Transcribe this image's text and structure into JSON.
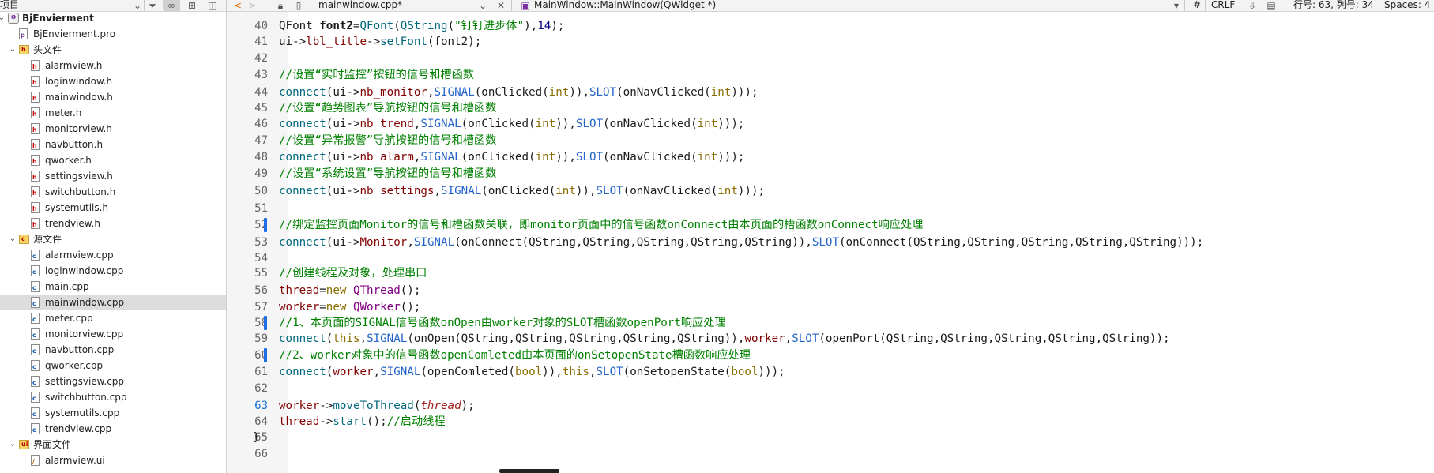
{
  "toolbar": {
    "project_label": "项目",
    "file_tab": "mainwindow.cpp*",
    "function_selector": "MainWindow::MainWindow(QWidget *)",
    "hash_label": "#",
    "line_ending": "CRLF",
    "cursor_position": "行号: 63, 列号: 34",
    "indentation": "Spaces: 4"
  },
  "tree": {
    "items": [
      {
        "label": "BjEnvierment",
        "kind": "project",
        "depth": 0,
        "arrow": "open",
        "bold": true
      },
      {
        "label": "BjEnvierment.pro",
        "kind": "pro",
        "depth": 1
      },
      {
        "label": "头文件",
        "kind": "folder-h",
        "depth": 1,
        "arrow": "open"
      },
      {
        "label": "alarmview.h",
        "kind": "h",
        "depth": 2
      },
      {
        "label": "loginwindow.h",
        "kind": "h",
        "depth": 2
      },
      {
        "label": "mainwindow.h",
        "kind": "h",
        "depth": 2
      },
      {
        "label": "meter.h",
        "kind": "h",
        "depth": 2
      },
      {
        "label": "monitorview.h",
        "kind": "h",
        "depth": 2
      },
      {
        "label": "navbutton.h",
        "kind": "h",
        "depth": 2
      },
      {
        "label": "qworker.h",
        "kind": "h",
        "depth": 2
      },
      {
        "label": "settingsview.h",
        "kind": "h",
        "depth": 2
      },
      {
        "label": "switchbutton.h",
        "kind": "h",
        "depth": 2
      },
      {
        "label": "systemutils.h",
        "kind": "h",
        "depth": 2
      },
      {
        "label": "trendview.h",
        "kind": "h",
        "depth": 2
      },
      {
        "label": "源文件",
        "kind": "folder-c",
        "depth": 1,
        "arrow": "open"
      },
      {
        "label": "alarmview.cpp",
        "kind": "cpp",
        "depth": 2
      },
      {
        "label": "loginwindow.cpp",
        "kind": "cpp",
        "depth": 2
      },
      {
        "label": "main.cpp",
        "kind": "cpp",
        "depth": 2
      },
      {
        "label": "mainwindow.cpp",
        "kind": "cpp",
        "depth": 2,
        "selected": true
      },
      {
        "label": "meter.cpp",
        "kind": "cpp",
        "depth": 2
      },
      {
        "label": "monitorview.cpp",
        "kind": "cpp",
        "depth": 2
      },
      {
        "label": "navbutton.cpp",
        "kind": "cpp",
        "depth": 2
      },
      {
        "label": "qworker.cpp",
        "kind": "cpp",
        "depth": 2
      },
      {
        "label": "settingsview.cpp",
        "kind": "cpp",
        "depth": 2
      },
      {
        "label": "switchbutton.cpp",
        "kind": "cpp",
        "depth": 2
      },
      {
        "label": "systemutils.cpp",
        "kind": "cpp",
        "depth": 2
      },
      {
        "label": "trendview.cpp",
        "kind": "cpp",
        "depth": 2
      },
      {
        "label": "界面文件",
        "kind": "folder-ui",
        "depth": 1,
        "arrow": "open"
      },
      {
        "label": "alarmview.ui",
        "kind": "ui",
        "depth": 2
      }
    ]
  },
  "editor": {
    "current_line": 63,
    "changed_lines": [
      52,
      58,
      60
    ],
    "lines": [
      {
        "n": 40,
        "tokens": [
          [
            "QFont ",
            "t-var"
          ],
          [
            "font2",
            "t-bold"
          ],
          [
            "=",
            ""
          ],
          [
            "QFont",
            "t-fn"
          ],
          [
            "(",
            ""
          ],
          [
            "QString",
            "t-fn"
          ],
          [
            "(",
            ""
          ],
          [
            "\"钉钉进步体\"",
            "t-str"
          ],
          [
            "),",
            ""
          ],
          [
            "14",
            "t-num"
          ],
          [
            ");",
            ""
          ]
        ]
      },
      {
        "n": 41,
        "tokens": [
          [
            "ui->",
            ""
          ],
          [
            "lbl_title",
            "t-mem"
          ],
          [
            "->",
            ""
          ],
          [
            "setFont",
            "t-fn"
          ],
          [
            "(font2);",
            ""
          ]
        ]
      },
      {
        "n": 42,
        "tokens": []
      },
      {
        "n": 43,
        "tokens": [
          [
            "//设置“实时监控”按钮的信号和槽函数",
            "t-cm"
          ]
        ]
      },
      {
        "n": 44,
        "tokens": [
          [
            "connect",
            "t-fn"
          ],
          [
            "(ui->",
            ""
          ],
          [
            "nb_monitor",
            "t-mem"
          ],
          [
            ",",
            ""
          ],
          [
            "SIGNAL",
            "t-macro"
          ],
          [
            "(onClicked(",
            ""
          ],
          [
            "int",
            "t-kw"
          ],
          [
            ")),",
            ""
          ],
          [
            "SLOT",
            "t-macro"
          ],
          [
            "(onNavClicked(",
            ""
          ],
          [
            "int",
            "t-kw"
          ],
          [
            ")));",
            ""
          ]
        ]
      },
      {
        "n": 45,
        "tokens": [
          [
            "//设置“趋势图表”导航按钮的信号和槽函数",
            "t-cm"
          ]
        ]
      },
      {
        "n": 46,
        "tokens": [
          [
            "connect",
            "t-fn"
          ],
          [
            "(ui->",
            ""
          ],
          [
            "nb_trend",
            "t-mem"
          ],
          [
            ",",
            ""
          ],
          [
            "SIGNAL",
            "t-macro"
          ],
          [
            "(onClicked(",
            ""
          ],
          [
            "int",
            "t-kw"
          ],
          [
            ")),",
            ""
          ],
          [
            "SLOT",
            "t-macro"
          ],
          [
            "(onNavClicked(",
            ""
          ],
          [
            "int",
            "t-kw"
          ],
          [
            ")));",
            ""
          ]
        ]
      },
      {
        "n": 47,
        "tokens": [
          [
            "//设置“异常报警”导航按钮的信号和槽函数",
            "t-cm"
          ]
        ]
      },
      {
        "n": 48,
        "tokens": [
          [
            "connect",
            "t-fn"
          ],
          [
            "(ui->",
            ""
          ],
          [
            "nb_alarm",
            "t-mem"
          ],
          [
            ",",
            ""
          ],
          [
            "SIGNAL",
            "t-macro"
          ],
          [
            "(onClicked(",
            ""
          ],
          [
            "int",
            "t-kw"
          ],
          [
            ")),",
            ""
          ],
          [
            "SLOT",
            "t-macro"
          ],
          [
            "(onNavClicked(",
            ""
          ],
          [
            "int",
            "t-kw"
          ],
          [
            ")));",
            ""
          ]
        ]
      },
      {
        "n": 49,
        "tokens": [
          [
            "//设置“系统设置”导航按钮的信号和槽函数",
            "t-cm"
          ]
        ]
      },
      {
        "n": 50,
        "tokens": [
          [
            "connect",
            "t-fn"
          ],
          [
            "(ui->",
            ""
          ],
          [
            "nb_settings",
            "t-mem"
          ],
          [
            ",",
            ""
          ],
          [
            "SIGNAL",
            "t-macro"
          ],
          [
            "(onClicked(",
            ""
          ],
          [
            "int",
            "t-kw"
          ],
          [
            ")),",
            ""
          ],
          [
            "SLOT",
            "t-macro"
          ],
          [
            "(onNavClicked(",
            ""
          ],
          [
            "int",
            "t-kw"
          ],
          [
            ")));",
            ""
          ]
        ]
      },
      {
        "n": 51,
        "tokens": []
      },
      {
        "n": 52,
        "tokens": [
          [
            "//绑定监控页面Monitor的信号和槽函数关联，即monitor页面中的信号函数onConnect由本页面的槽函数onConnect响应处理",
            "t-cm"
          ]
        ]
      },
      {
        "n": 53,
        "tokens": [
          [
            "connect",
            "t-fn"
          ],
          [
            "(ui->",
            ""
          ],
          [
            "Monitor",
            "t-mem"
          ],
          [
            ",",
            ""
          ],
          [
            "SIGNAL",
            "t-macro"
          ],
          [
            "(onConnect(QString,QString,QString,QString,QString)),",
            ""
          ],
          [
            "SLOT",
            "t-macro"
          ],
          [
            "(onConnect(QString,QString,QString,QString,QString)));",
            ""
          ]
        ]
      },
      {
        "n": 54,
        "tokens": []
      },
      {
        "n": 55,
        "tokens": [
          [
            "//创建线程及对象，处理串口",
            "t-cm"
          ]
        ]
      },
      {
        "n": 56,
        "tokens": [
          [
            "thread",
            "t-mem"
          ],
          [
            "=",
            ""
          ],
          [
            "new ",
            "t-kw"
          ],
          [
            "QThread",
            "t-type"
          ],
          [
            "();",
            ""
          ]
        ]
      },
      {
        "n": 57,
        "tokens": [
          [
            "worker",
            "t-mem"
          ],
          [
            "=",
            ""
          ],
          [
            "new ",
            "t-kw"
          ],
          [
            "QWorker",
            "t-type"
          ],
          [
            "();",
            ""
          ]
        ]
      },
      {
        "n": 58,
        "tokens": [
          [
            "//1、本页面的SIGNAL信号函数onOpen由worker对象的SLOT槽函数openPort响应处理",
            "t-cm"
          ]
        ]
      },
      {
        "n": 59,
        "tokens": [
          [
            "connect",
            "t-fn"
          ],
          [
            "(",
            ""
          ],
          [
            "this",
            "t-kw"
          ],
          [
            ",",
            ""
          ],
          [
            "SIGNAL",
            "t-macro"
          ],
          [
            "(onOpen(QString,QString,QString,QString,QString)),",
            ""
          ],
          [
            "worker",
            "t-mem"
          ],
          [
            ",",
            ""
          ],
          [
            "SLOT",
            "t-macro"
          ],
          [
            "(openPort(QString,QString,QString,QString,QString));",
            ""
          ]
        ]
      },
      {
        "n": 60,
        "tokens": [
          [
            "//2、worker对象中的信号函数openComleted由本页面的onSetopenState槽函数响应处理",
            "t-cm"
          ]
        ]
      },
      {
        "n": 61,
        "tokens": [
          [
            "connect",
            "t-fn"
          ],
          [
            "(",
            ""
          ],
          [
            "worker",
            "t-mem"
          ],
          [
            ",",
            ""
          ],
          [
            "SIGNAL",
            "t-macro"
          ],
          [
            "(openComleted(",
            ""
          ],
          [
            "bool",
            "t-kw"
          ],
          [
            ")),",
            ""
          ],
          [
            "this",
            "t-kw"
          ],
          [
            ",",
            ""
          ],
          [
            "SLOT",
            "t-macro"
          ],
          [
            "(onSetopenState(",
            ""
          ],
          [
            "bool",
            "t-kw"
          ],
          [
            ")));",
            ""
          ]
        ]
      },
      {
        "n": 62,
        "tokens": []
      },
      {
        "n": 63,
        "tokens": [
          [
            "worker",
            "t-mem"
          ],
          [
            "->",
            ""
          ],
          [
            "moveToThread",
            "t-fn"
          ],
          [
            "(",
            ""
          ],
          [
            "thread",
            "t-it"
          ],
          [
            ");",
            ""
          ]
        ]
      },
      {
        "n": 64,
        "tokens": [
          [
            "thread",
            "t-mem"
          ],
          [
            "->",
            ""
          ],
          [
            "start",
            "t-fn"
          ],
          [
            "();",
            ""
          ],
          [
            "//启动线程",
            "t-cm"
          ]
        ]
      },
      {
        "n": 65,
        "tokens": [
          [
            "}",
            ""
          ]
        ],
        "outdent": true
      },
      {
        "n": 66,
        "tokens": []
      }
    ]
  }
}
